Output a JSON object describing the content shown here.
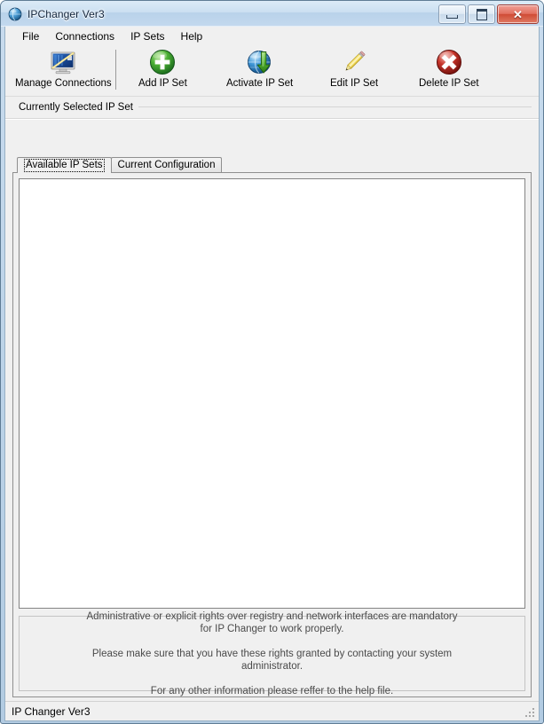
{
  "window": {
    "title": "IPChanger Ver3",
    "app_icon": "globe-icon",
    "caption": {
      "minimize_label": "Minimize",
      "maximize_label": "Maximize",
      "close_label": "Close",
      "close_glyph": "✕"
    }
  },
  "menubar": {
    "items": [
      {
        "label": "File",
        "name": "menu-file"
      },
      {
        "label": "Connections",
        "name": "menu-connections"
      },
      {
        "label": "IP Sets",
        "name": "menu-ip-sets"
      },
      {
        "label": "Help",
        "name": "menu-help"
      }
    ]
  },
  "toolbar": {
    "buttons": [
      {
        "label": "Manage Connections",
        "icon": "monitor-network-icon",
        "name": "toolbar-manage-connections"
      },
      {
        "label": "Add IP Set",
        "icon": "green-plus-circle-icon",
        "name": "toolbar-add-ip-set"
      },
      {
        "label": "Activate IP Set",
        "icon": "globe-green-arrow-icon",
        "name": "toolbar-activate-ip-set"
      },
      {
        "label": "Edit IP Set",
        "icon": "pencil-icon",
        "name": "toolbar-edit-ip-set"
      },
      {
        "label": "Delete IP Set",
        "icon": "red-x-circle-icon",
        "name": "toolbar-delete-ip-set"
      }
    ]
  },
  "selected_strip": {
    "label": "Currently Selected IP Set",
    "value": ""
  },
  "tabs": [
    {
      "label": "Available IP Sets",
      "active": true,
      "name": "tab-available-ip-sets"
    },
    {
      "label": "Current Configuration",
      "active": false,
      "name": "tab-current-configuration"
    }
  ],
  "list": {
    "items": [],
    "empty": true
  },
  "info_panel": {
    "paragraphs": [
      "Administrative or explicit rights over registry and network interfaces are mandatory for IP Changer to work properly.",
      "Please make sure that you have these rights granted by contacting your system administrator.",
      "For any other information please reffer to the help file."
    ]
  },
  "statusbar": {
    "text": "IP Changer Ver3"
  },
  "colors": {
    "window_frame": "#b2cbe2",
    "client_bg": "#f0f0f0",
    "list_bg": "#ffffff",
    "close_button": "#cf4b35",
    "add_icon_green": "#3f9a24",
    "delete_icon_red": "#c02822",
    "pencil_yellow": "#f2e06a"
  }
}
